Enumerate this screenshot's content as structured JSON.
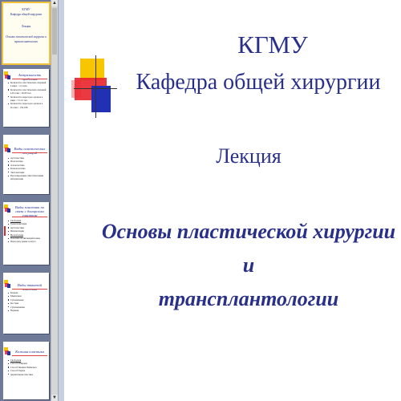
{
  "thumbnails": [
    {
      "lines": [
        "КГМУ",
        "Кафедра общей хирургии",
        "Лекция",
        "Основы пластической хирургии и трансплантологии"
      ]
    },
    {
      "title": "Актуальность проблемы",
      "items": [
        "Количество пластических операций в мире ~ 2-3 млн",
        "Количество пластических операций в России ~ 40-60 тыс.",
        "Количество пересадок органов в мире ~ 15-12 тыс.",
        "Количество пересадок органов в России ~ 150-180."
      ]
    },
    {
      "title": "Виды пластических операций",
      "items": [
        "Аутопластика",
        "Изопластика",
        "Аллопластика",
        "Ксенопластика",
        "Эксплантация",
        "Протезирование синтетическими материалами"
      ]
    },
    {
      "title": "Виды пластики по связи с донорским участком",
      "items": [
        "Свободная",
        "Трансплантация",
        "Аутопластика",
        "Имплантация",
        "Несвободная",
        "Пластика на питающей ножке",
        "Пересадку ремня лоскута"
      ]
    },
    {
      "title": "Виды тканевой пластики",
      "items": [
        "Кожная",
        "Мышечная",
        "Сухожильная",
        "Костная",
        "Сухожилиевая",
        "Нервная"
      ]
    },
    {
      "title": "Кожная пластика",
      "items": [
        "Свободная",
        "Способ Реверена",
        "Способ Янович-Чайнского",
        "Способ Тирша",
        "Дерматомная пластика"
      ]
    }
  ],
  "slide": {
    "line1": "КГМУ",
    "line2": "Кафедра общей хирургии",
    "lecture": "Лекция",
    "topic_line1": "Основы пластической хирургии и",
    "topic_line2": "трансплантологии"
  },
  "scrollbar": {
    "up": "▲",
    "down": "▼"
  },
  "colors": {
    "pane": "#6e7a97",
    "title_blue": "#29308a",
    "logo_yellow": "#f7c600",
    "logo_red": "#e9242c",
    "logo_blue": "#2230b4"
  }
}
